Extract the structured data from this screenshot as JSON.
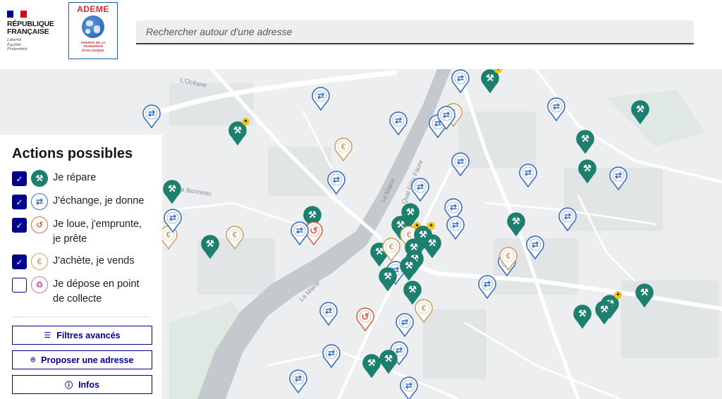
{
  "header": {
    "gov_logo": {
      "line1": "RÉPUBLIQUE",
      "line2": "FRANÇAISE",
      "motto1": "Liberté",
      "motto2": "Égalité",
      "motto3": "Fraternité",
      "flag_colors": [
        "#000091",
        "#ffffff",
        "#e1000f"
      ]
    },
    "ademe_logo": {
      "title": "ADEME",
      "sub1": "AGENCE DE LA",
      "sub2": "TRANSITION",
      "sub3": "ÉCOLOGIQUE"
    },
    "search_placeholder": "Rechercher autour d'une adresse"
  },
  "map": {
    "zoom_in": "+",
    "zoom_out": "−",
    "street_labels": [
      "L'Océane",
      "La Maine",
      "La Maine",
      "Quai Félix Faure",
      "Rue Bonneau"
    ]
  },
  "panel": {
    "title": "Actions possibles",
    "filters": [
      {
        "label": "Je répare",
        "checked": true,
        "icon": "wrench-icon"
      },
      {
        "label": "J'échange, je donne",
        "checked": true,
        "icon": "exchange-hand-icon"
      },
      {
        "label_line1": "Je loue, j'emprunte,",
        "label_line2": "je prête",
        "checked": true,
        "icon": "return-arrow-icon"
      },
      {
        "label": "J'achète, je vends",
        "checked": true,
        "icon": "euro-icon"
      },
      {
        "label_line1": "Je dépose en point",
        "label_line2": "de collecte",
        "checked": false,
        "icon": "recycle-icon"
      }
    ],
    "buttons": {
      "filters": "Filtres avancés",
      "propose": "Proposer une adresse",
      "infos": "Infos"
    }
  },
  "colors": {
    "repare": "#1d7f6e",
    "echange": "#3a6ec0",
    "loue": "#d8664b",
    "achete": "#c9a267",
    "depose": "#c173b9",
    "primary": "#000091"
  }
}
